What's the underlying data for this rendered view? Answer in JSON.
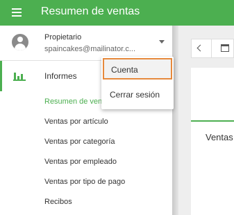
{
  "appbar": {
    "title": "Resumen de ventas",
    "menu_icon": "hamburger-menu-icon",
    "color": "#4caf50"
  },
  "account": {
    "role": "Propietario",
    "email": "spaincakes@mailinator.c...",
    "avatar_icon": "account-circle-icon",
    "caret_icon": "caret-down-icon"
  },
  "nav": {
    "section_label": "Informes",
    "section_icon": "bar-chart-icon",
    "items": [
      {
        "label": "Resumen de vent"
      },
      {
        "label": "Ventas por artículo"
      },
      {
        "label": "Ventas por categoría"
      },
      {
        "label": "Ventas por empleado"
      },
      {
        "label": "Ventas por tipo de pago"
      },
      {
        "label": "Recibos"
      }
    ]
  },
  "account_menu": {
    "items": [
      {
        "label": "Cuenta"
      },
      {
        "label": "Cerrar sesión"
      }
    ]
  },
  "main": {
    "toolbar_icons": [
      "chevron-left-icon",
      "calendar-icon"
    ],
    "tab_label": "Ventas"
  }
}
